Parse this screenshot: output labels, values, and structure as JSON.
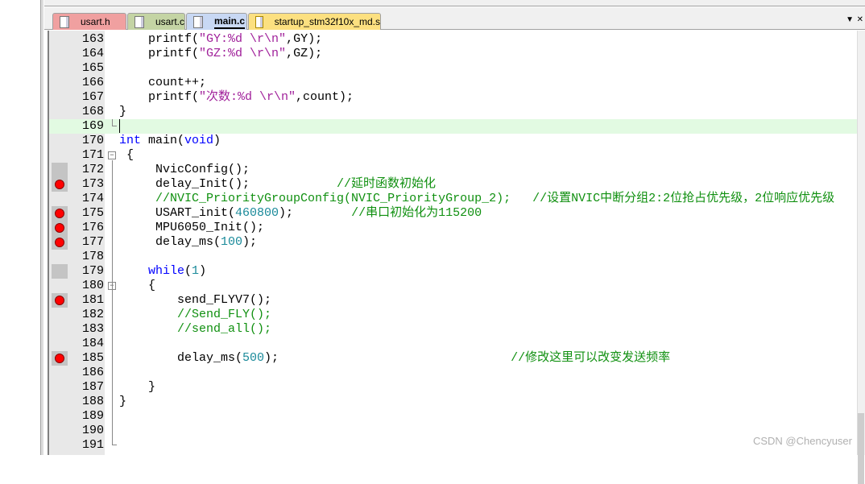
{
  "tabs": [
    {
      "label": "usart.h",
      "color": "#f0a0a0",
      "icon": "file-icon",
      "active": false
    },
    {
      "label": "usart.c",
      "color": "#c4d4a4",
      "icon": "file-icon",
      "active": false
    },
    {
      "label": "main.c",
      "color": "#c8d8f4",
      "icon": "file-icon",
      "active": true
    },
    {
      "label": "startup_stm32f10x_md.s",
      "color": "#fce080",
      "icon": "key-file-icon",
      "active": false
    }
  ],
  "tab_menu_icon": "▼",
  "close_icon": "✕",
  "watermark": "CSDN @Chencyuser",
  "current_line": 169,
  "lines": [
    {
      "n": 163,
      "tokens": [
        [
          "    printf(",
          "tx"
        ],
        [
          "\"GY:%d \\r\\n\"",
          "str"
        ],
        [
          ",GY);",
          "tx"
        ]
      ]
    },
    {
      "n": 164,
      "tokens": [
        [
          "    printf(",
          "tx"
        ],
        [
          "\"GZ:%d \\r\\n\"",
          "str"
        ],
        [
          ",GZ);",
          "tx"
        ]
      ]
    },
    {
      "n": 165,
      "tokens": []
    },
    {
      "n": 166,
      "tokens": [
        [
          "    count++;",
          "tx"
        ]
      ]
    },
    {
      "n": 167,
      "tokens": [
        [
          "    printf(",
          "tx"
        ],
        [
          "\"次数:%d \\r\\n\"",
          "str"
        ],
        [
          ",count);",
          "tx"
        ]
      ]
    },
    {
      "n": 168,
      "tokens": [
        [
          "}",
          "tx"
        ]
      ]
    },
    {
      "n": 169,
      "tokens": [],
      "fold": "end"
    },
    {
      "n": 170,
      "tokens": [
        [
          "int",
          "kw"
        ],
        [
          " main(",
          "tx"
        ],
        [
          "void",
          "kw"
        ],
        [
          ")",
          "tx"
        ]
      ]
    },
    {
      "n": 171,
      "tokens": [
        [
          " {",
          "tx"
        ]
      ],
      "fold": "open"
    },
    {
      "n": 172,
      "tokens": [
        [
          "     NvicConfig();",
          "tx"
        ]
      ],
      "gray": true
    },
    {
      "n": 173,
      "tokens": [
        [
          "     delay_Init();            ",
          "tx"
        ],
        [
          "//延时函数初始化",
          "cm"
        ]
      ],
      "gray": true,
      "bp": true
    },
    {
      "n": 174,
      "tokens": [
        [
          "     ",
          "tx"
        ],
        [
          "//NVIC_PriorityGroupConfig(NVIC_PriorityGroup_2);   //设置NVIC中断分组2:2位抢占优先级，2位响应优先级",
          "cm"
        ]
      ]
    },
    {
      "n": 175,
      "tokens": [
        [
          "     USART_init(",
          "tx"
        ],
        [
          "460800",
          "nm"
        ],
        [
          ");        ",
          "tx"
        ],
        [
          "//串口初始化为115200",
          "cm"
        ]
      ],
      "gray": true,
      "bp": true
    },
    {
      "n": 176,
      "tokens": [
        [
          "     MPU6050_Init();",
          "tx"
        ]
      ],
      "gray": true,
      "bp": true
    },
    {
      "n": 177,
      "tokens": [
        [
          "     delay_ms(",
          "tx"
        ],
        [
          "100",
          "nm"
        ],
        [
          ");",
          "tx"
        ]
      ],
      "gray": true,
      "bp": true
    },
    {
      "n": 178,
      "tokens": []
    },
    {
      "n": 179,
      "tokens": [
        [
          "    ",
          "tx"
        ],
        [
          "while",
          "kw"
        ],
        [
          "(",
          "tx"
        ],
        [
          "1",
          "nm"
        ],
        [
          ")",
          "tx"
        ]
      ],
      "gray": true
    },
    {
      "n": 180,
      "tokens": [
        [
          "    {",
          "tx"
        ]
      ],
      "fold": "open"
    },
    {
      "n": 181,
      "tokens": [
        [
          "        send_FLYV7();",
          "tx"
        ]
      ],
      "gray": true,
      "bp": true
    },
    {
      "n": 182,
      "tokens": [
        [
          "        ",
          "tx"
        ],
        [
          "//Send_FLY();",
          "cm"
        ]
      ]
    },
    {
      "n": 183,
      "tokens": [
        [
          "        ",
          "tx"
        ],
        [
          "//send_all();",
          "cm"
        ]
      ]
    },
    {
      "n": 184,
      "tokens": []
    },
    {
      "n": 185,
      "tokens": [
        [
          "        delay_ms(",
          "tx"
        ],
        [
          "500",
          "nm"
        ],
        [
          ");                                ",
          "tx"
        ],
        [
          "//修改这里可以改变发送频率",
          "cm"
        ]
      ],
      "gray": true,
      "bp": true
    },
    {
      "n": 186,
      "tokens": []
    },
    {
      "n": 187,
      "tokens": [
        [
          "    }",
          "tx"
        ]
      ]
    },
    {
      "n": 188,
      "tokens": [
        [
          "}",
          "tx"
        ]
      ]
    },
    {
      "n": 189,
      "tokens": []
    },
    {
      "n": 190,
      "tokens": []
    },
    {
      "n": 191,
      "tokens": [],
      "fold": "end"
    }
  ]
}
